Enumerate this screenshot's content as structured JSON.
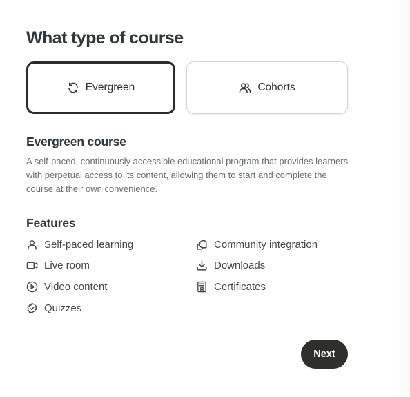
{
  "page": {
    "title": "What type of course"
  },
  "course_type": {
    "options": [
      {
        "label": "Evergreen",
        "icon": "refresh-icon",
        "selected": true
      },
      {
        "label": "Cohorts",
        "icon": "users-icon",
        "selected": false
      }
    ]
  },
  "description": {
    "title": "Evergreen course",
    "text": "A self-paced, continuously accessible educational program that provides learners with perpetual access to its content, allowing them to start and complete the course at their own convenience."
  },
  "features": {
    "title": "Features",
    "items": [
      {
        "label": "Self-paced learning",
        "icon": "user-icon"
      },
      {
        "label": "Community integration",
        "icon": "chat-bubbles-icon"
      },
      {
        "label": "Live room",
        "icon": "video-camera-icon"
      },
      {
        "label": "Downloads",
        "icon": "download-icon"
      },
      {
        "label": "Video content",
        "icon": "play-circle-icon"
      },
      {
        "label": "Certificates",
        "icon": "certificate-icon"
      },
      {
        "label": "Quizzes",
        "icon": "badge-check-icon"
      }
    ]
  },
  "actions": {
    "next_label": "Next"
  },
  "colors": {
    "text_primary": "#33373a",
    "text_secondary": "#6a6d70",
    "selected_border": "#2b2d2f",
    "button_bg": "#2f2f2d",
    "button_text": "#ffffff"
  }
}
